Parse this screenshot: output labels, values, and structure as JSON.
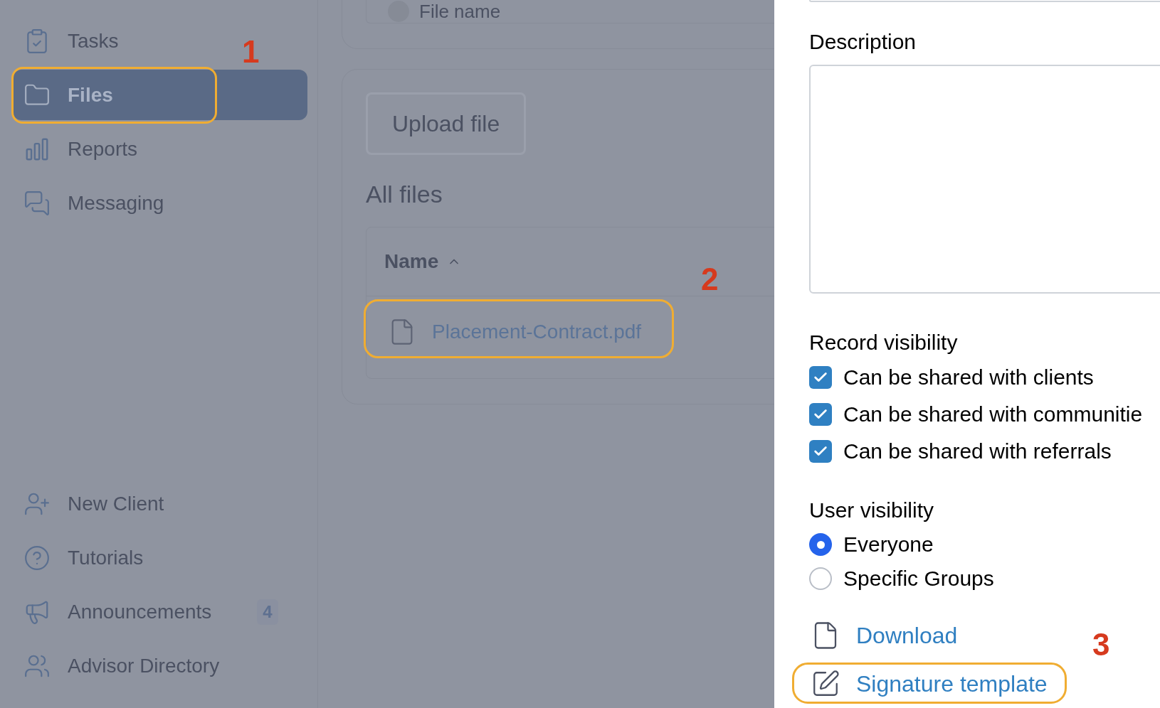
{
  "sidebar": {
    "top_items": [
      {
        "label": "Tasks",
        "selected": false,
        "highlighted": false
      },
      {
        "label": "Files",
        "selected": true,
        "highlighted": true,
        "annotation": "1"
      },
      {
        "label": "Reports",
        "selected": false,
        "highlighted": false
      },
      {
        "label": "Messaging",
        "selected": false,
        "highlighted": false
      }
    ],
    "bottom_items": [
      {
        "label": "New Client",
        "selected": false
      },
      {
        "label": "Tutorials",
        "selected": false
      },
      {
        "label": "Announcements",
        "selected": false,
        "badge": "4"
      },
      {
        "label": "Advisor Directory",
        "selected": false
      }
    ]
  },
  "main": {
    "top_card": {
      "field_label": "File name"
    },
    "upload_button": "Upload file",
    "section_title": "All files",
    "table": {
      "columns": [
        {
          "label": "Name",
          "sorted": true
        }
      ],
      "rows": [
        {
          "name": "Placement-Contract.pdf",
          "highlighted": true,
          "annotation": "2"
        }
      ]
    }
  },
  "panel": {
    "description": {
      "label": "Description"
    },
    "record_visibility": {
      "label": "Record visibility",
      "options": [
        {
          "label": "Can be shared with clients",
          "checked": true
        },
        {
          "label": "Can be shared with communitie",
          "checked": true
        },
        {
          "label": "Can be shared with referrals",
          "checked": true
        }
      ]
    },
    "user_visibility": {
      "label": "User visibility",
      "options": [
        {
          "label": "Everyone",
          "selected": true
        },
        {
          "label": "Specific Groups",
          "selected": false
        }
      ]
    },
    "links": [
      {
        "kind": "download",
        "label": "Download",
        "highlighted": false
      },
      {
        "kind": "edit",
        "label": "Signature template",
        "highlighted": true,
        "annotation": "3"
      }
    ]
  }
}
